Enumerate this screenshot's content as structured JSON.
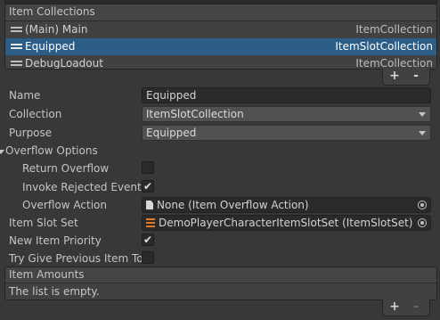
{
  "item_collections": {
    "header": "Item Collections",
    "rows": [
      {
        "label": "(Main) Main",
        "type": "ItemCollection",
        "selected": false
      },
      {
        "label": "Equipped",
        "type": "ItemSlotCollection",
        "selected": true
      },
      {
        "label": "DebugLoadout",
        "type": "ItemCollection",
        "selected": false
      }
    ],
    "add_label": "+",
    "remove_label": "-"
  },
  "properties": {
    "name": {
      "label": "Name",
      "value": "Equipped"
    },
    "collection": {
      "label": "Collection",
      "value": "ItemSlotCollection"
    },
    "purpose": {
      "label": "Purpose",
      "value": "Equipped"
    },
    "overflow_options": {
      "label": "Overflow Options",
      "return_overflow": {
        "label": "Return Overflow",
        "checked": false
      },
      "invoke_rejected_event": {
        "label": "Invoke Rejected Event",
        "checked": true
      },
      "overflow_action": {
        "label": "Overflow Action",
        "value": "None (Item Overflow Action)"
      }
    },
    "item_slot_set": {
      "label": "Item Slot Set",
      "value": "DemoPlayerCharacterItemSlotSet (ItemSlotSet)"
    },
    "new_item_priority": {
      "label": "New Item Priority",
      "checked": true
    },
    "try_give_previous": {
      "label": "Try Give Previous Item To",
      "checked": false
    }
  },
  "item_amounts": {
    "header": "Item Amounts",
    "empty_text": "The list is empty.",
    "add_label": "+",
    "remove_label": "-"
  },
  "colors": {
    "background": "#383838",
    "selection": "#2c5d87",
    "field": "#2a2a2a"
  },
  "icons": [
    "drag-handle-icon",
    "document-icon",
    "object-picker-icon",
    "scriptable-asset-icon",
    "dropdown-caret-icon",
    "foldout-arrow-icon",
    "checkmark-icon"
  ]
}
